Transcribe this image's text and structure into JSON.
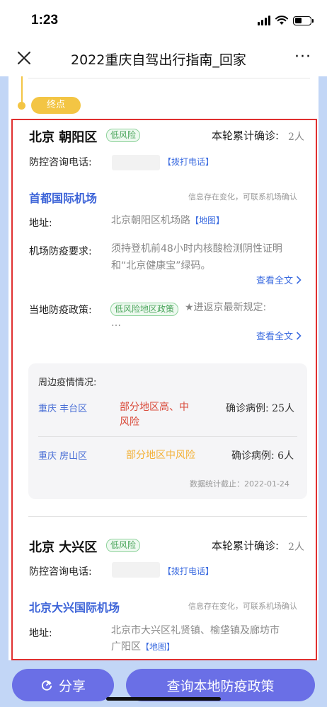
{
  "status_bar": {
    "time": "1:23"
  },
  "nav": {
    "title": "2022重庆自驾出行指南_回家",
    "more": "···"
  },
  "timeline": {
    "end_label": "终点"
  },
  "sections": [
    {
      "district": "北京 朝阳区",
      "risk": "低风险",
      "confirmed_label": "本轮累计确诊:",
      "confirmed_value": "2人",
      "phone_label": "防控咨询电话:",
      "call_link": "【拨打电话】",
      "airport": "首都国际机场",
      "airport_note": "信息存在变化，可联系机场确认",
      "address_label": "地址:",
      "address": "北京朝阳区机场路",
      "map_link": "【地图】",
      "requirement_label": "机场防疫要求:",
      "requirement_lines": [
        "须持登机前48小时内核酸检测阴性证明",
        "和“北京健康宝”绿码。"
      ],
      "read_more_1": "查看全文",
      "policy_label": "当地防疫政策:",
      "policy_badge": "低风险地区政策",
      "policy_text": "★进返京最新规定:",
      "policy_ellipsis": "…",
      "read_more_2": "查看全文",
      "surrounding": {
        "title": "周边疫情情况:",
        "rows": [
          {
            "area": "重庆 丰台区",
            "risk_lines": [
              "部分地区高、中",
              "风险"
            ],
            "cases_label": "确诊病例:",
            "cases": "25人"
          },
          {
            "area": "重庆 房山区",
            "risk": "部分地区中风险",
            "cases_label": "确诊病例:",
            "cases": "6人"
          }
        ],
        "stat_date": "数据统计截止：2022-01-24"
      }
    },
    {
      "district": "北京 大兴区",
      "risk": "低风险",
      "confirmed_label": "本轮累计确诊:",
      "confirmed_value": "2人",
      "phone_label": "防控咨询电话:",
      "call_link": "【拨打电话】",
      "airport": "北京大兴国际机场",
      "airport_note": "信息存在变化，可联系机场确认",
      "address_label": "地址:",
      "address_lines": [
        "北京市大兴区礼贤镇、榆垡镇及廊坊市",
        "广阳区"
      ],
      "map_link": "【地图】"
    }
  ],
  "bottom": {
    "share": "分享",
    "query": "查询本地防疫政策"
  },
  "colors": {
    "accent": "#6a6fe6",
    "link": "#3c6ce0",
    "low_risk": "#4aa55b",
    "high_risk": "#d94a3a",
    "mid_risk": "#f3b23a",
    "end_badge": "#f3c544"
  }
}
